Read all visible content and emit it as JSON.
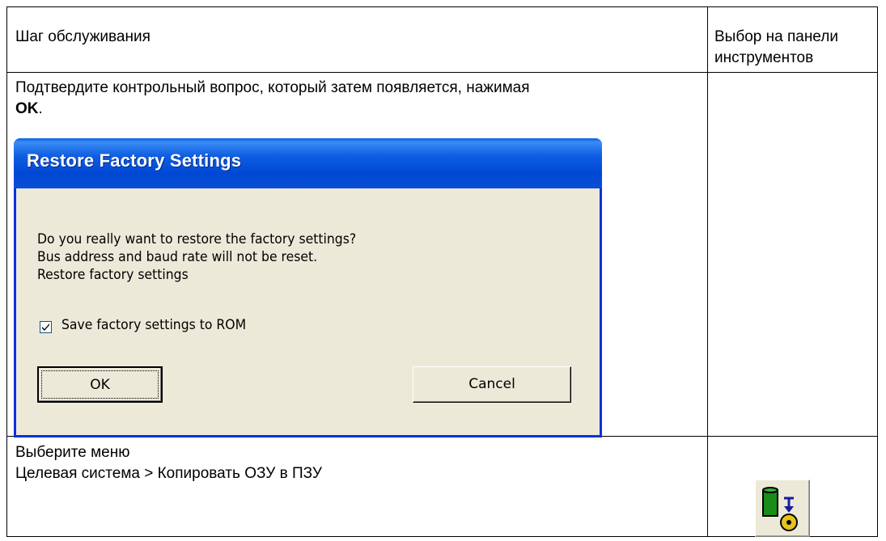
{
  "table": {
    "col_step": "Шаг обслуживания",
    "col_toolbar_line1": "Выбор на панели",
    "col_toolbar_line2": "инструментов"
  },
  "row1": {
    "text_line1": "Подтвердите контрольный вопрос, который затем появляется, нажимая",
    "ok_label": "OK",
    "text_tail": "."
  },
  "dialog": {
    "title": "Restore Factory Settings",
    "message_line1": "Do you really want to restore the factory settings?",
    "message_line2": "Bus address and baud rate will not be reset.",
    "message_line3": "Restore factory settings",
    "checkbox_label": "Save factory settings to ROM",
    "checkbox_checked": true,
    "ok_button": "OK",
    "cancel_button": "Cancel"
  },
  "row2": {
    "text_line1": "Выберите меню",
    "menu_path": "Целевая система > Копировать ОЗУ в ПЗУ",
    "toolbar_icon": "copy-ram-to-rom-icon"
  },
  "colors": {
    "title_bar": "#0a4ed7",
    "dialog_bg": "#ece9d8",
    "icon_green": "#1a8c1a",
    "icon_yellow": "#e6c21a",
    "icon_blue": "#1a1aa0"
  }
}
